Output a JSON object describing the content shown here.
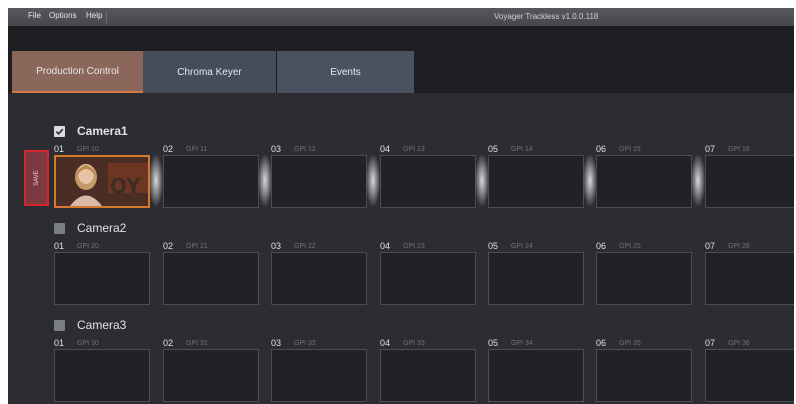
{
  "menu": {
    "file": "File",
    "options": "Options",
    "help": "Help"
  },
  "app_title": "Voyager Trackless v1.0.0.118",
  "tabs": [
    {
      "label": "Production Control",
      "active": true
    },
    {
      "label": "Chroma Keyer",
      "active": false
    },
    {
      "label": "Events",
      "active": false
    }
  ],
  "save_label": "SAVE",
  "cameras": [
    {
      "name": "Camera1",
      "checked": true,
      "slots": [
        {
          "num": "01",
          "gpi": "GPI 10"
        },
        {
          "num": "02",
          "gpi": "GPI 11"
        },
        {
          "num": "03",
          "gpi": "GPI 12"
        },
        {
          "num": "04",
          "gpi": "GPI 13"
        },
        {
          "num": "05",
          "gpi": "GPI 14"
        },
        {
          "num": "06",
          "gpi": "GPI 15"
        },
        {
          "num": "07",
          "gpi": "GPI 16"
        }
      ]
    },
    {
      "name": "Camera2",
      "checked": false,
      "slots": [
        {
          "num": "01",
          "gpi": "GPI 20"
        },
        {
          "num": "02",
          "gpi": "GPI 21"
        },
        {
          "num": "03",
          "gpi": "GPI 22"
        },
        {
          "num": "04",
          "gpi": "GPI 23"
        },
        {
          "num": "05",
          "gpi": "GPI 24"
        },
        {
          "num": "06",
          "gpi": "GPI 25"
        },
        {
          "num": "07",
          "gpi": "GPI 26"
        }
      ]
    },
    {
      "name": "Camera3",
      "checked": false,
      "slots": [
        {
          "num": "01",
          "gpi": "GPI 30"
        },
        {
          "num": "02",
          "gpi": "GPI 31"
        },
        {
          "num": "03",
          "gpi": "GPI 32"
        },
        {
          "num": "04",
          "gpi": "GPI 33"
        },
        {
          "num": "05",
          "gpi": "GPI 34"
        },
        {
          "num": "06",
          "gpi": "GPI 35"
        },
        {
          "num": "07",
          "gpi": "GPI 36"
        }
      ]
    }
  ],
  "colors": {
    "accent": "#d6792f",
    "save_border": "#d4262c",
    "active_tab": "#8a675a"
  }
}
